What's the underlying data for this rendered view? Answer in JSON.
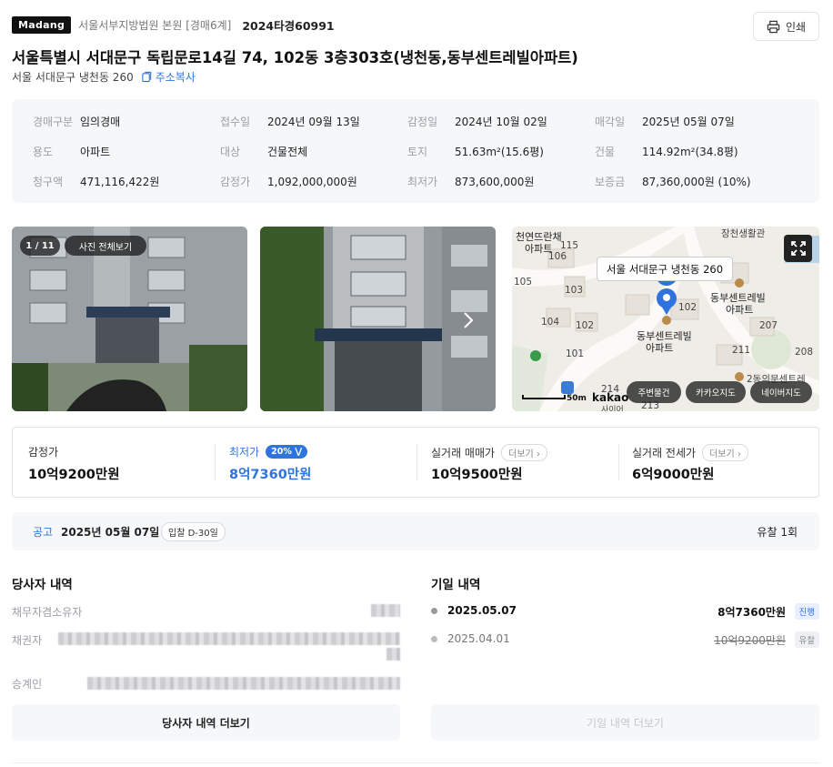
{
  "header": {
    "logo": "Madang",
    "court": "서울서부지방법원 본원 [경매6계]",
    "case_no": "2024타경60991",
    "print_label": "인쇄"
  },
  "title": "서울특별시 서대문구 독립문로14길 74, 102동 3층303호(냉천동,동부센트레빌아파트)",
  "sub_address": "서울 서대문구 냉천동 260",
  "copy_label": "주소복사",
  "info": {
    "rows": [
      [
        {
          "k": "경매구분",
          "v": "임의경매"
        },
        {
          "k": "접수일",
          "v": "2024년 09월 13일"
        },
        {
          "k": "감정일",
          "v": "2024년 10월 02일"
        },
        {
          "k": "매각일",
          "v": "2025년 05월 07일"
        }
      ],
      [
        {
          "k": "용도",
          "v": "아파트"
        },
        {
          "k": "대상",
          "v": "건물전체"
        },
        {
          "k": "토지",
          "v": "51.63m²(15.6평)"
        },
        {
          "k": "건물",
          "v": "114.92m²(34.8평)"
        }
      ],
      [
        {
          "k": "청구액",
          "v": "471,116,422원"
        },
        {
          "k": "감정가",
          "v": "1,092,000,000원"
        },
        {
          "k": "최저가",
          "v": "873,600,000원"
        },
        {
          "k": "보증금",
          "v": "87,360,000원 (10%)"
        }
      ]
    ]
  },
  "gallery": {
    "count_label": "1 / 11",
    "view_all_label": "사진 전체보기"
  },
  "map": {
    "tooltip": "서울 서대문구 냉천동 260",
    "labels": [
      "장천생활관",
      "천연뜨란채",
      "아파트",
      "115",
      "106",
      "103",
      "105",
      "104",
      "102",
      "101",
      "102",
      "동부센트레빌",
      "아파트",
      "동부센트레빌",
      "아파트",
      "207",
      "211",
      "208",
      "214",
      "2동의문센트레",
      "213",
      "사이어"
    ],
    "scale_label": "50m",
    "brand": "kakao",
    "btn_nearby": "주변물건",
    "btn_kakao": "카카오지도",
    "btn_naver": "네이버지도"
  },
  "prices": {
    "appraisal": {
      "k": "감정가",
      "v": "10억9200만원"
    },
    "minimum": {
      "k": "최저가",
      "badge": "20%",
      "v": "8억7360만원"
    },
    "sale": {
      "k": "실거래 매매가",
      "more": "더보기",
      "v": "10억9500만원"
    },
    "jeonse": {
      "k": "실거래 전세가",
      "more": "더보기",
      "v": "6억9000만원"
    }
  },
  "notice": {
    "label": "공고",
    "date": "2025년 05월 07일",
    "dday": "입찰 D-30일",
    "fail_count": "유찰 1회"
  },
  "parties": {
    "title": "당사자 내역",
    "debtor_label": "채무자겸소유자",
    "creditor_label": "채권자",
    "successor_label": "승계인",
    "more_label": "당사자 내역 더보기"
  },
  "history": {
    "title": "기일 내역",
    "items": [
      {
        "date": "2025.05.07",
        "price": "8억7360만원",
        "status": "진행"
      },
      {
        "date": "2025.04.01",
        "price": "10억9200만원",
        "status": "유찰"
      }
    ],
    "more_label": "기일 내역 더보기"
  }
}
